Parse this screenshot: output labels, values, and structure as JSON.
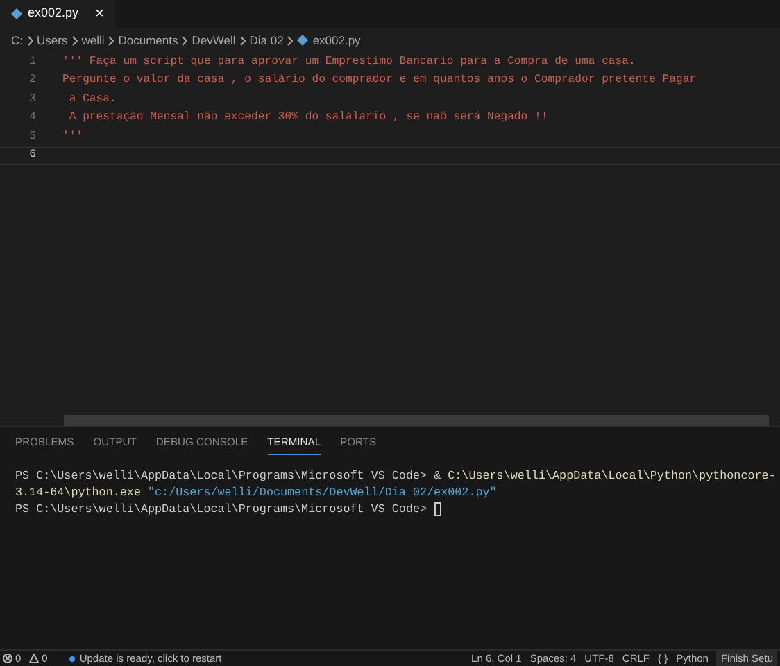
{
  "tabs": [
    {
      "label": "ex002.py",
      "selected": true,
      "close": "×"
    }
  ],
  "breadcrumb": [
    "C:",
    "Users",
    "welli",
    "Documents",
    "DevWell",
    "Dia 02",
    "ex002.py"
  ],
  "editor": {
    "lines": [
      {
        "number": "1",
        "text": "''' Faça um script que para aprovar um Emprestimo Bancario para a Compra de uma casa.",
        "current": false
      },
      {
        "number": "2",
        "text": "Pergunte o valor da casa , o salário do comprador e em quantos anos o Comprador pretente Pagar",
        "current": false
      },
      {
        "number": "3",
        "text": " a Casa.",
        "current": false
      },
      {
        "number": "4",
        "text": " A prestação Mensal não exceder 30% do salálario , se naõ será Negado !!",
        "current": false
      },
      {
        "number": "5",
        "text": "'''",
        "current": false
      },
      {
        "number": "6",
        "current": true
      }
    ]
  },
  "panel": {
    "tabs": [
      {
        "label": "PROBLEMS",
        "selected": false
      },
      {
        "label": "OUTPUT",
        "selected": false
      },
      {
        "label": "DEBUG CONSOLE",
        "selected": false
      },
      {
        "label": "TERMINAL",
        "selected": true
      },
      {
        "label": "PORTS",
        "selected": false
      }
    ],
    "terminal": [
      [
        {
          "kind": "prompt",
          "text": "PS C:\\Users\\welli\\AppData\\Local\\Programs\\Microsoft VS Code> "
        },
        {
          "kind": "operator",
          "text": "& "
        },
        {
          "kind": "command",
          "text": "C:\\Users\\welli\\AppData\\Local\\Python\\pythoncore-"
        }
      ],
      [
        {
          "kind": "command",
          "text": "3.14-64\\python.exe "
        },
        {
          "kind": "string",
          "text": "\"c:/Users/welli/Documents/DevWell/Dia 02/ex002.py\""
        }
      ],
      [
        {
          "kind": "prompt",
          "text": "PS C:\\Users\\welli\\AppData\\Local\\Programs\\Microsoft VS Code> "
        }
      ]
    ]
  },
  "status_bar": {
    "errors": "0",
    "warnings": "0",
    "update": "Update is ready, click to restart",
    "position": "Ln 6, Col 1",
    "spaces": "Spaces: 4",
    "encoding": "UTF-8",
    "eol": "CRLF",
    "braces": "{ }",
    "language": "Python",
    "setup": "Finish Setu"
  }
}
